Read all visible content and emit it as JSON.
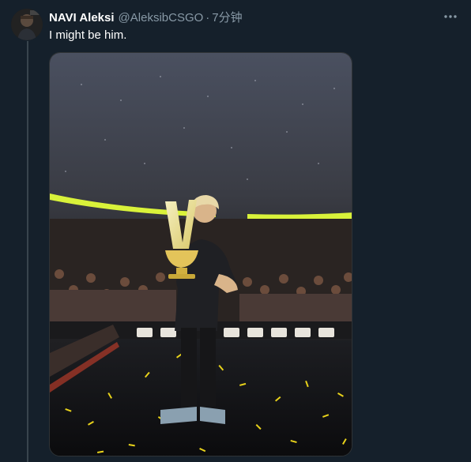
{
  "tweet": {
    "display_name": "NAVI Aleksi",
    "handle": "@AleksibCSGO",
    "separator": "·",
    "time": "7分钟",
    "text": "I might be him.",
    "more_icon": "ellipsis-icon",
    "media": {
      "type": "photo",
      "subject": "player kissing trophy on confetti-covered stage in arena"
    }
  },
  "colors": {
    "background": "#15202b",
    "secondary_text": "#8899a6",
    "thread_line": "#38444d",
    "arena_lights": "#d9f23a",
    "confetti": "#e8d21a"
  }
}
